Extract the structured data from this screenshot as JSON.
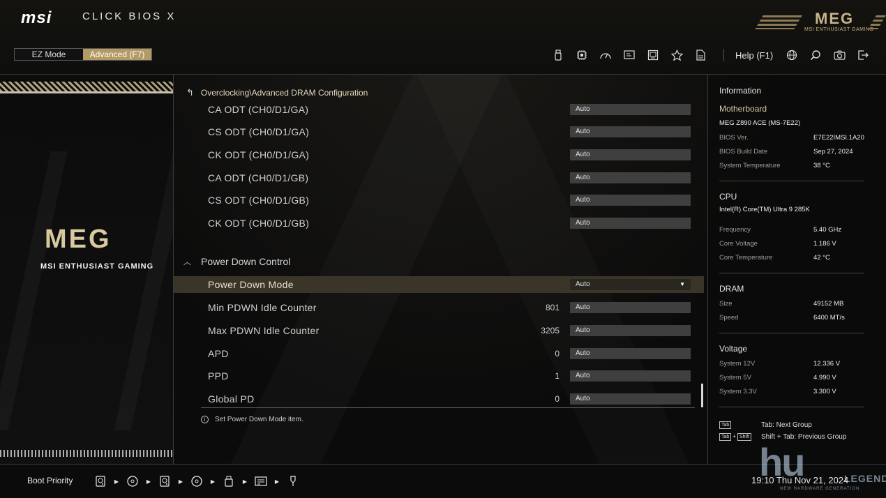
{
  "header": {
    "brand": "msi",
    "product": "CLICK BIOS X",
    "logo_word": "MEG",
    "logo_sub": "MSI ENTHUSIAST GAMING",
    "mode_ez": "EZ Mode",
    "mode_advanced": "Advanced (F7)",
    "help": "Help (F1)",
    "icons": [
      "usb-icon",
      "cpu-icon",
      "gauge-icon",
      "hardware-monitor-icon",
      "memory-icon",
      "favorite-star-icon",
      "document-icon",
      "language-globe-icon",
      "search-icon",
      "screenshot-camera-icon",
      "exit-icon"
    ]
  },
  "left_panel": {
    "logo_word": "MEG",
    "logo_text": "MSI ENTHUSIAST GAMING"
  },
  "main": {
    "breadcrumb": "Overclocking\\Advanced DRAM Configuration",
    "rows": [
      {
        "label": "CA ODT (CH0/D1/GA)",
        "value": "Auto"
      },
      {
        "label": "CS ODT (CH0/D1/GA)",
        "value": "Auto"
      },
      {
        "label": "CK ODT (CH0/D1/GA)",
        "value": "Auto"
      },
      {
        "label": "CA ODT (CH0/D1/GB)",
        "value": "Auto"
      },
      {
        "label": "CS ODT (CH0/D1/GB)",
        "value": "Auto"
      },
      {
        "label": "CK ODT (CH0/D1/GB)",
        "value": "Auto"
      }
    ],
    "group_title": "Power Down Control",
    "power_rows": [
      {
        "label": "Power Down Mode",
        "current": "",
        "value": "Auto"
      },
      {
        "label": "Min PDWN Idle Counter",
        "current": "801",
        "value": "Auto"
      },
      {
        "label": "Max PDWN Idle Counter",
        "current": "3205",
        "value": "Auto"
      },
      {
        "label": "APD",
        "current": "0",
        "value": "Auto"
      },
      {
        "label": "PPD",
        "current": "1",
        "value": "Auto"
      },
      {
        "label": "Global PD",
        "current": "0",
        "value": "Auto"
      }
    ],
    "help_text": "Set Power Down Mode item."
  },
  "info": {
    "title": "Information",
    "motherboard": {
      "heading": "Motherboard",
      "model": "MEG Z890 ACE (MS-7E22)",
      "items": [
        {
          "key": "BIOS Ver.",
          "value": "E7E22IMSI.1A20"
        },
        {
          "key": "BIOS Build Date",
          "value": "Sep 27, 2024"
        },
        {
          "key": "System Temperature",
          "value": "38 °C"
        }
      ]
    },
    "cpu": {
      "heading": "CPU",
      "model": "Intel(R) Core(TM) Ultra 9 285K",
      "items": [
        {
          "key": "Frequency",
          "value": "5.40 GHz"
        },
        {
          "key": "Core Voltage",
          "value": "1.186 V"
        },
        {
          "key": "Core Temperature",
          "value": "42 °C"
        }
      ]
    },
    "dram": {
      "heading": "DRAM",
      "items": [
        {
          "key": "Size",
          "value": "49152 MB"
        },
        {
          "key": "Speed",
          "value": "6400 MT/s"
        }
      ]
    },
    "voltage": {
      "heading": "Voltage",
      "items": [
        {
          "key": "System 12V",
          "value": "12.336 V"
        },
        {
          "key": "System 5V",
          "value": "4.990 V"
        },
        {
          "key": "System 3.3V",
          "value": "3.300 V"
        }
      ]
    },
    "shortcuts": [
      {
        "keys": [
          "Tab"
        ],
        "text": "Tab: Next Group"
      },
      {
        "keys": [
          "Tab",
          "Shift"
        ],
        "text": "Shift + Tab: Previous Group"
      }
    ]
  },
  "footer": {
    "boot_label": "Boot Priority",
    "boot_devices": [
      "hdd-icon",
      "disc-icon",
      "hdd-icon",
      "disc-icon",
      "usb-drive-icon",
      "network-card-icon",
      "usb-key-icon"
    ],
    "clock": "19:10  Thu Nov 21, 2024"
  },
  "watermark": {
    "big": "hu",
    "end": "LEGEND",
    "tag": "NEW HARDWARE GENERATION"
  }
}
